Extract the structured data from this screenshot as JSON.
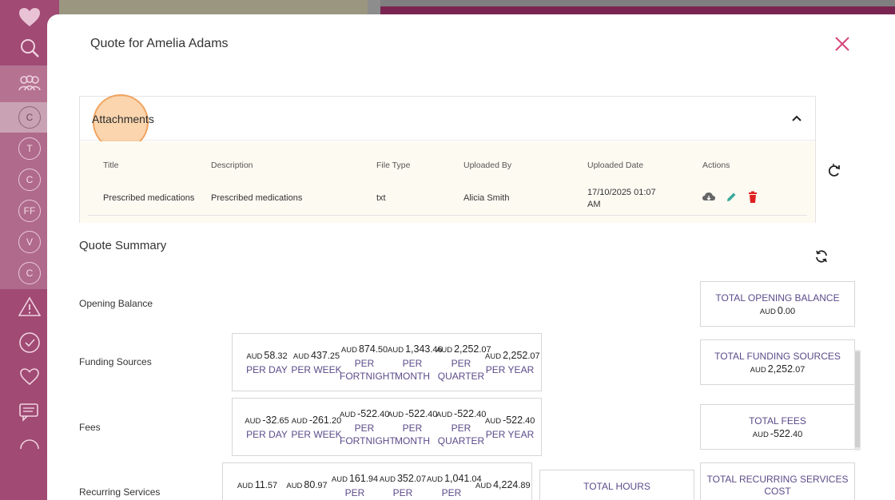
{
  "modal": {
    "title": "Quote for Amelia Adams"
  },
  "sidebar": {
    "circles": [
      "C",
      "T",
      "C",
      "FF",
      "V",
      "C"
    ]
  },
  "attachments": {
    "heading": "Attachments",
    "columns": [
      "Title",
      "Description",
      "File Type",
      "Uploaded By",
      "Uploaded Date",
      "Actions"
    ],
    "rows": [
      {
        "title": "Prescribed medications",
        "description": "Prescribed medications",
        "file_type": "txt",
        "uploaded_by": "Alicia Smith",
        "uploaded_date_line1": "17/10/2025 01:07",
        "uploaded_date_line2": "AM"
      }
    ]
  },
  "summary": {
    "title": "Quote Summary",
    "currency": "AUD",
    "rows": {
      "opening": {
        "label": "Opening Balance",
        "total_label": "TOTAL OPENING BALANCE",
        "total_value": "0",
        "total_cents": ".00"
      },
      "funding": {
        "label": "Funding Sources",
        "cells": [
          {
            "amount": "58",
            "cents": ".32",
            "per1": "PER DAY",
            "per2": ""
          },
          {
            "amount": "437",
            "cents": ".25",
            "per1": "PER WEEK",
            "per2": ""
          },
          {
            "amount": "874",
            "cents": ".50",
            "per1": "PER",
            "per2": "FORTNIGHT"
          },
          {
            "amount": "1,343",
            "cents": ".46",
            "per1": "PER",
            "per2": "MONTH"
          },
          {
            "amount": "2,252",
            "cents": ".07",
            "per1": "PER",
            "per2": "QUARTER"
          },
          {
            "amount": "2,252",
            "cents": ".07",
            "per1": "PER YEAR",
            "per2": ""
          }
        ],
        "total_label": "TOTAL FUNDING SOURCES",
        "total_value": "2,252",
        "total_cents": ".07"
      },
      "fees": {
        "label": "Fees",
        "cells": [
          {
            "amount": "-32",
            "cents": ".65",
            "per1": "PER DAY",
            "per2": ""
          },
          {
            "amount": "-261",
            "cents": ".20",
            "per1": "PER WEEK",
            "per2": ""
          },
          {
            "amount": "-522",
            "cents": ".40",
            "per1": "PER",
            "per2": "FORTNIGHT"
          },
          {
            "amount": "-522",
            "cents": ".40",
            "per1": "PER",
            "per2": "MONTH"
          },
          {
            "amount": "-522",
            "cents": ".40",
            "per1": "PER",
            "per2": "QUARTER"
          },
          {
            "amount": "-522",
            "cents": ".40",
            "per1": "PER YEAR",
            "per2": ""
          }
        ],
        "total_label": "TOTAL FEES",
        "total_value": "-522",
        "total_cents": ".40"
      },
      "recurring": {
        "label": "Recurring Services",
        "cells": [
          {
            "amount": "11",
            "cents": ".57",
            "per1": ""
          },
          {
            "amount": "80",
            "cents": ".97",
            "per1": ""
          },
          {
            "amount": "161",
            "cents": ".94",
            "per1": "PER"
          },
          {
            "amount": "352",
            "cents": ".07",
            "per1": "PER"
          },
          {
            "amount": "1,041",
            "cents": ".04",
            "per1": "PER"
          },
          {
            "amount": "4,224",
            "cents": ".89",
            "per1": ""
          }
        ],
        "hours_label": "TOTAL HOURS",
        "total_label_line1": "TOTAL RECURRING SERVICES",
        "total_label_line2": "COST"
      }
    }
  },
  "colors": {
    "accent": "#5c4b8a",
    "close": "#d6477a",
    "sidebar": "#a04a74",
    "highlight": "#f6b26b",
    "delete": "#e02020",
    "edit": "#3aa89c"
  }
}
